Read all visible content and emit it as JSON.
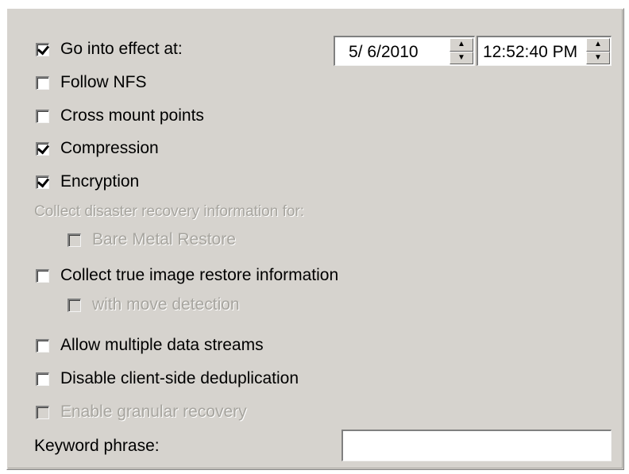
{
  "options": {
    "go_into_effect": {
      "label": "Go into effect at:",
      "checked": true
    },
    "follow_nfs": {
      "label": "Follow NFS",
      "checked": false
    },
    "cross_mount_points": {
      "label": "Cross mount points",
      "checked": false
    },
    "compression": {
      "label": "Compression",
      "checked": true
    },
    "encryption": {
      "label": "Encryption",
      "checked": true
    },
    "disaster_recovery_heading": "Collect disaster recovery information for:",
    "bare_metal_restore": {
      "label": "Bare Metal Restore",
      "checked": false,
      "enabled": false
    },
    "true_image_restore": {
      "label": "Collect true image restore information",
      "checked": false
    },
    "move_detection": {
      "label": "with move detection",
      "checked": false,
      "enabled": false
    },
    "multiple_data_streams": {
      "label": "Allow multiple data streams",
      "checked": false
    },
    "disable_dedup": {
      "label": "Disable client-side deduplication",
      "checked": false
    },
    "granular_recovery": {
      "label": "Enable granular recovery",
      "checked": false,
      "enabled": false
    }
  },
  "effective_date": "5/ 6/2010",
  "effective_time": "12:52:40 PM",
  "keyword": {
    "label": "Keyword phrase:",
    "value": ""
  }
}
